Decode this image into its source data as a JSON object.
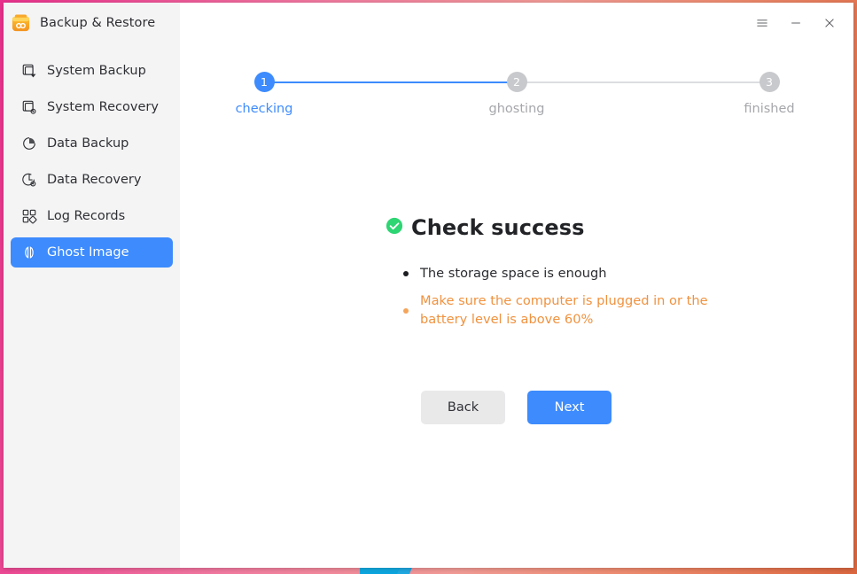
{
  "window": {
    "title": "Backup & Restore",
    "logo_icon": "backup-app-logo-icon",
    "controls": [
      {
        "name": "menu-button",
        "icon": "hamburger-menu-icon",
        "label": "☰"
      },
      {
        "name": "minimize-button",
        "icon": "minimize-icon",
        "label": "–"
      },
      {
        "name": "close-button",
        "icon": "close-icon",
        "label": "✕"
      }
    ]
  },
  "sidebar": {
    "items": [
      {
        "label": "System Backup",
        "icon": "system-backup-icon",
        "active": false
      },
      {
        "label": "System Recovery",
        "icon": "system-recovery-icon",
        "active": false
      },
      {
        "label": "Data Backup",
        "icon": "data-backup-icon",
        "active": false
      },
      {
        "label": "Data Recovery",
        "icon": "data-recovery-icon",
        "active": false
      },
      {
        "label": "Log Records",
        "icon": "log-records-icon",
        "active": false
      },
      {
        "label": "Ghost Image",
        "icon": "ghost-image-icon",
        "active": true
      }
    ]
  },
  "stepper": {
    "steps": [
      {
        "number": "1",
        "label": "checking",
        "state": "active"
      },
      {
        "number": "2",
        "label": "ghosting",
        "state": "inactive"
      },
      {
        "number": "3",
        "label": "finished",
        "state": "inactive"
      }
    ]
  },
  "main": {
    "status_icon": "success-check-icon",
    "heading": "Check success",
    "items": [
      {
        "text": "The storage space is enough",
        "type": "normal"
      },
      {
        "text": "Make sure the computer is plugged in or the battery level is above 60%",
        "type": "warning"
      }
    ]
  },
  "buttons": {
    "back": "Back",
    "next": "Next"
  },
  "colors": {
    "accent_blue": "#3d8bfd",
    "warning_orange": "#f0923f",
    "success_green": "#2ed573",
    "step_inactive_gray": "#c8c9cc",
    "sidebar_bg": "#f4f4f5",
    "logo_orange": "#f5a623"
  }
}
